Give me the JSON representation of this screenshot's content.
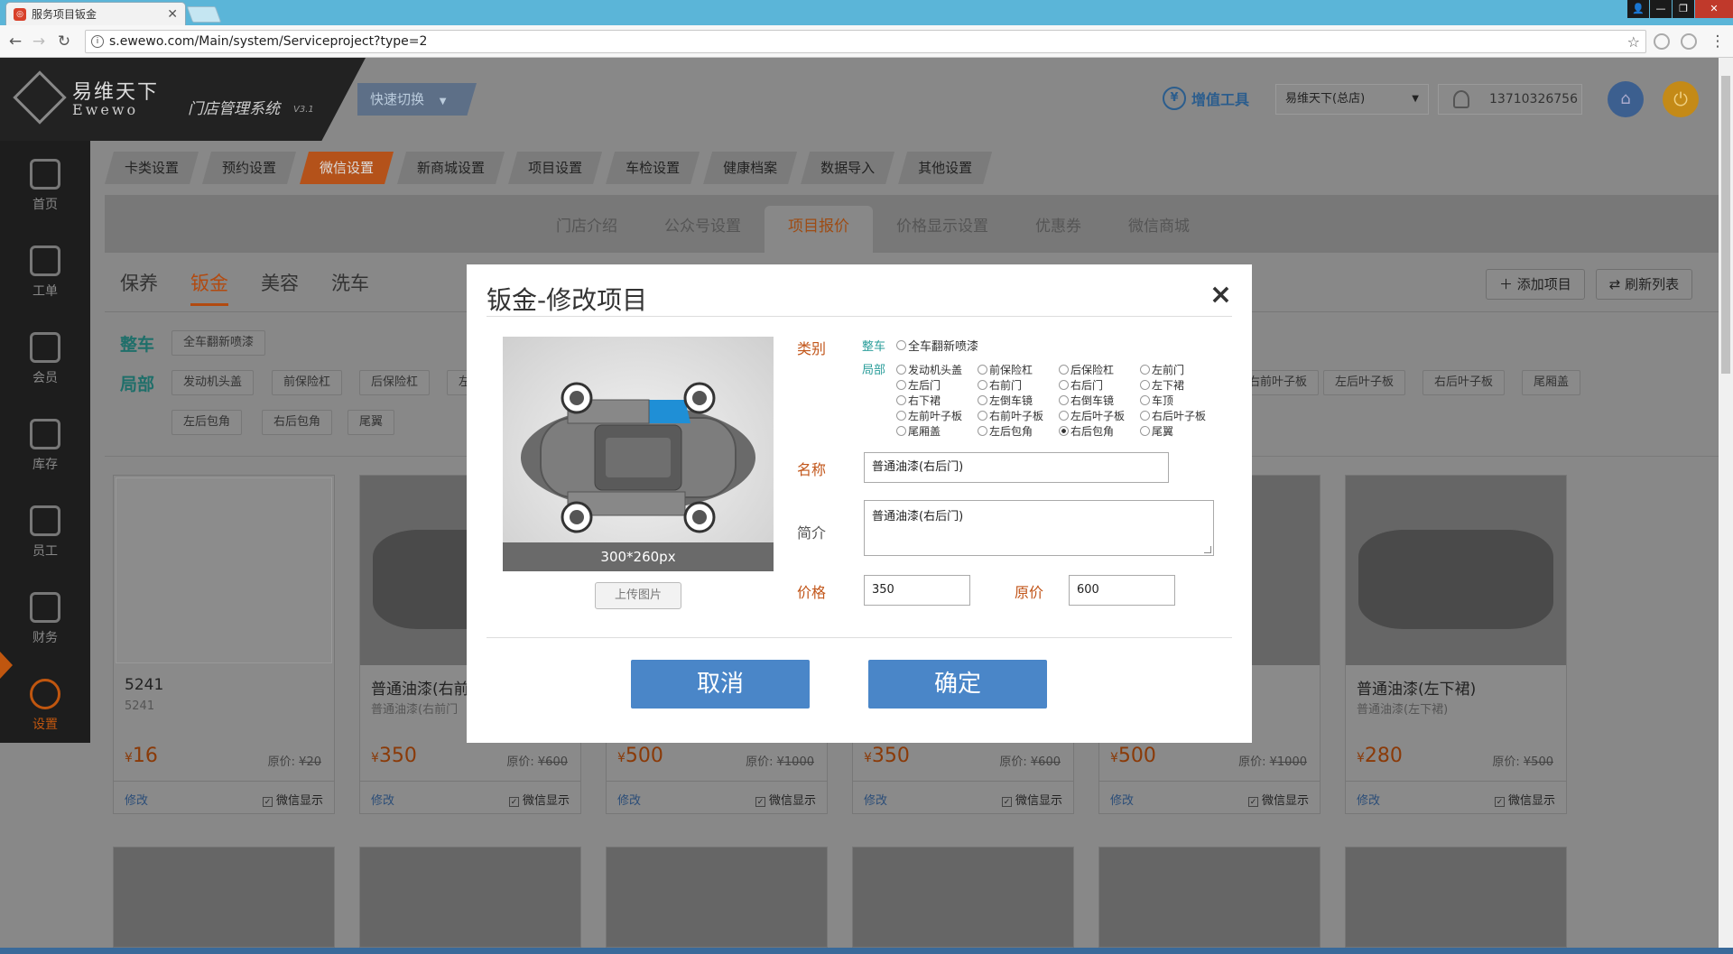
{
  "browser": {
    "tab_title": "服务项目钣金",
    "url": "s.ewewo.com/Main/system/Serviceproject?type=2",
    "win_buttons": [
      "👤",
      "—",
      "❐",
      "✕"
    ]
  },
  "header": {
    "logo_cn": "易维天下",
    "logo_en": "Ewewo",
    "system_name": "门店管理系统",
    "version": "V3.1",
    "quick_switch": "快速切换",
    "tools": "增值工具",
    "store": "易维天下(总店)",
    "phone": "13710326756"
  },
  "sidebar": {
    "items": [
      {
        "label": "首页"
      },
      {
        "label": "工单"
      },
      {
        "label": "会员"
      },
      {
        "label": "库存"
      },
      {
        "label": "员工"
      },
      {
        "label": "财务"
      },
      {
        "label": "设置"
      }
    ]
  },
  "topnav": {
    "tabs": [
      "卡类设置",
      "预约设置",
      "微信设置",
      "新商城设置",
      "项目设置",
      "车检设置",
      "健康档案",
      "数据导入",
      "其他设置"
    ],
    "active": "微信设置"
  },
  "subnav": {
    "tabs": [
      "门店介绍",
      "公众号设置",
      "项目报价",
      "价格显示设置",
      "优惠券",
      "微信商城"
    ],
    "active": "项目报价"
  },
  "category_tabs": [
    "保养",
    "钣金",
    "美容",
    "洗车"
  ],
  "actions": {
    "add": "添加项目",
    "refresh": "刷新列表"
  },
  "filters": {
    "whole_label": "整车",
    "whole": [
      "全车翻新喷漆"
    ],
    "part_label": "局部",
    "parts_row1": [
      "发动机头盖",
      "前保险杠",
      "后保险杠",
      "左"
    ],
    "parts_row1_right": [
      "右前叶子板",
      "左后叶子板",
      "右后叶子板",
      "尾厢盖"
    ],
    "parts_row2": [
      "左后包角",
      "右后包角",
      "尾翼"
    ]
  },
  "cards": [
    {
      "name": "5241",
      "desc": "5241",
      "price": "16",
      "orig_label": "原价:",
      "orig": "¥20",
      "edit": "修改",
      "show": "微信显示"
    },
    {
      "name": "普通油漆(右前",
      "desc": "普通油漆(右前门",
      "price": "350",
      "orig_label": "原价:",
      "orig": "¥600",
      "edit": "修改",
      "show": "微信显示"
    },
    {
      "name": "",
      "desc": "",
      "price": "500",
      "orig_label": "原价:",
      "orig": "¥1000",
      "edit": "修改",
      "show": "微信显示"
    },
    {
      "name": "",
      "desc": "",
      "price": "350",
      "orig_label": "原价:",
      "orig": "¥600",
      "edit": "修改",
      "show": "微信显示"
    },
    {
      "name": "",
      "desc": "",
      "price": "500",
      "orig_label": "原价:",
      "orig": "¥1000",
      "edit": "修改",
      "show": "微信显示"
    },
    {
      "name": "普通油漆(左下裙)",
      "desc": "普通油漆(左下裙)",
      "price": "280",
      "orig_label": "原价:",
      "orig": "¥500",
      "edit": "修改",
      "show": "微信显示"
    }
  ],
  "modal": {
    "title": "钣金-修改项目",
    "close": "×",
    "image_size": "300*260px",
    "upload": "上传图片",
    "category_label": "类别",
    "whole_label": "整车",
    "whole_options": [
      "全车翻新喷漆"
    ],
    "part_label": "局部",
    "part_options": [
      [
        "发动机头盖",
        "前保险杠",
        "后保险杠",
        "左前门"
      ],
      [
        "左后门",
        "右前门",
        "右后门",
        "左下裙"
      ],
      [
        "右下裙",
        "左倒车镜",
        "右倒车镜",
        "车顶"
      ],
      [
        "左前叶子板",
        "右前叶子板",
        "左后叶子板",
        "右后叶子板"
      ],
      [
        "尾厢盖",
        "左后包角",
        "右后包角",
        "尾翼"
      ]
    ],
    "selected_part": "右后包角",
    "name_label": "名称",
    "name_value": "普通油漆(右后门)",
    "desc_label": "简介",
    "desc_value": "普通油漆(右后门)",
    "price_label": "价格",
    "price_value": "350",
    "orig_label": "原价",
    "orig_value": "600",
    "cancel": "取消",
    "confirm": "确定"
  },
  "colors": {
    "accent": "#c0560f",
    "primary_button": "#4a86c8",
    "teal": "#2a9d9a"
  }
}
